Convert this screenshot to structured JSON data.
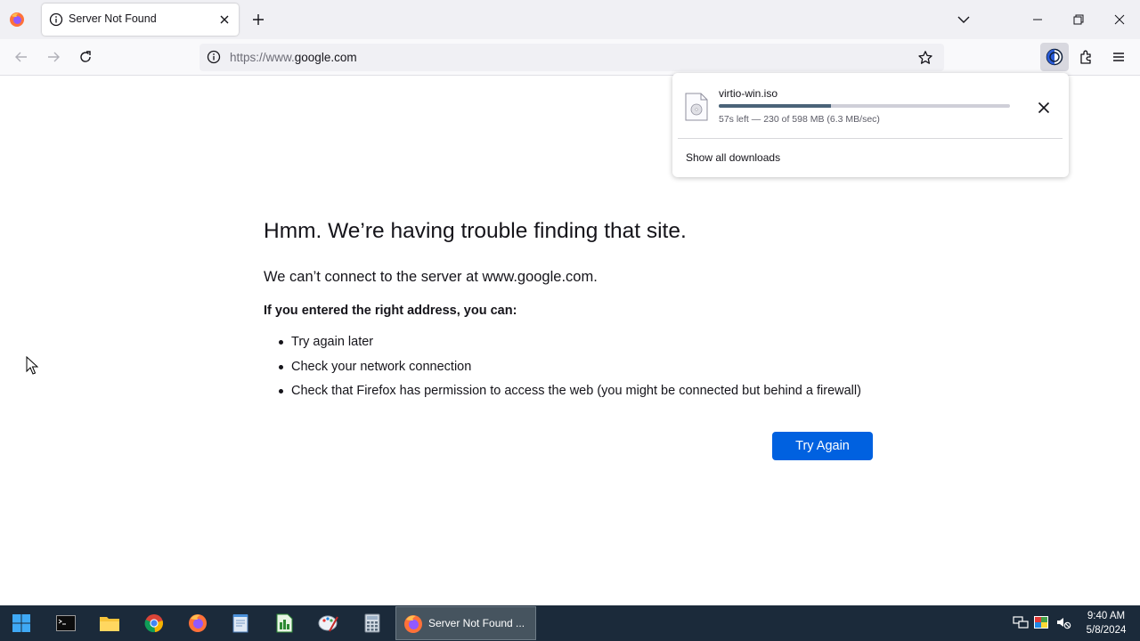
{
  "browser": {
    "tab": {
      "title": "Server Not Found"
    },
    "url": {
      "scheme": "https://www.",
      "host": "google.com"
    }
  },
  "downloads_panel": {
    "file_name": "virtio-win.iso",
    "progress_fraction": 0.3846,
    "status": "57s left — 230 of 598 MB (6.3 MB/sec)",
    "show_all": "Show all downloads"
  },
  "error_page": {
    "title": "Hmm. We’re having trouble finding that site.",
    "description": "We can’t connect to the server at www.google.com.",
    "subheading": "If you entered the right address, you can:",
    "suggestions": [
      "Try again later",
      "Check your network connection",
      "Check that Firefox has permission to access the web (you might be connected but behind a firewall)"
    ],
    "try_again_label": "Try Again"
  },
  "taskbar": {
    "active_window_label": "Server Not Found ...",
    "apps": [
      "start-icon",
      "terminal-icon",
      "file-explorer-icon",
      "chrome-icon",
      "firefox-icon",
      "notepad-icon",
      "spreadsheet-icon",
      "paint-icon",
      "calculator-icon"
    ],
    "clock": {
      "time": "9:40 AM",
      "date": "5/8/2024"
    }
  },
  "colors": {
    "accent": "#0061e0",
    "taskbar": "#1b2a3a",
    "tabstrip": "#f0f0f4",
    "progress": "#4a6378"
  }
}
